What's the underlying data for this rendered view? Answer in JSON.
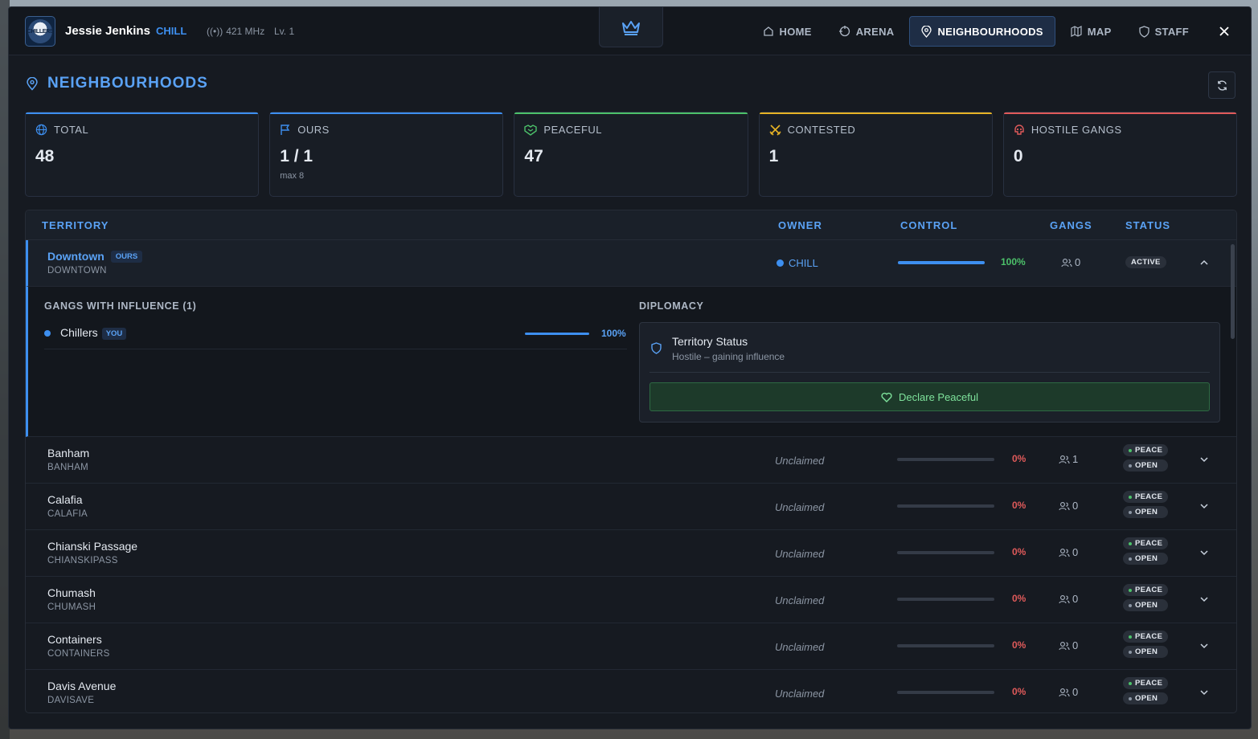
{
  "app": {
    "logo_text": "CHILLERS",
    "user_name": "Jessie Jenkins",
    "user_tag": "CHILL",
    "radio": "421 MHz",
    "level": "Lv. 1"
  },
  "nav": {
    "items": [
      {
        "label": "HOME",
        "icon": "home-icon"
      },
      {
        "label": "ARENA",
        "icon": "target-icon"
      },
      {
        "label": "NEIGHBOURHOODS",
        "icon": "pin-icon",
        "active": true
      },
      {
        "label": "MAP",
        "icon": "map-icon"
      },
      {
        "label": "STAFF",
        "icon": "shield-icon"
      }
    ],
    "close_icon": "close-icon"
  },
  "page": {
    "title": "NEIGHBOURHOODS"
  },
  "stats": [
    {
      "label": "TOTAL",
      "value": "48",
      "sub": "",
      "color": "#3d8ff0",
      "icon": "globe-icon"
    },
    {
      "label": "OURS",
      "value": "1 / 1",
      "sub": "max 8",
      "color": "#3d8ff0",
      "icon": "flag-icon"
    },
    {
      "label": "PEACEFUL",
      "value": "47",
      "sub": "",
      "color": "#4cc16a",
      "icon": "handshake-icon"
    },
    {
      "label": "CONTESTED",
      "value": "1",
      "sub": "",
      "color": "#e6b325",
      "icon": "swords-icon"
    },
    {
      "label": "HOSTILE GANGS",
      "value": "0",
      "sub": "",
      "color": "#e05a5a",
      "icon": "skull-icon"
    }
  ],
  "table": {
    "headers": {
      "territory": "TERRITORY",
      "owner": "OWNER",
      "control": "CONTROL",
      "gangs": "GANGS",
      "status": "STATUS"
    },
    "expanded": {
      "name": "Downtown",
      "badge": "OURS",
      "code": "DOWNTOWN",
      "owner": "CHILL",
      "control": 1.0,
      "control_label": "100%",
      "gangs": "0",
      "status": "ACTIVE",
      "influence_title": "GANGS WITH INFLUENCE (1)",
      "influence": [
        {
          "name": "Chillers",
          "badge": "YOU",
          "pct": "100%"
        }
      ],
      "diplomacy_title": "DIPLOMACY",
      "territory_status_title": "Territory Status",
      "territory_status_sub": "Hostile – gaining influence",
      "declare_label": "Declare Peaceful"
    },
    "rows": [
      {
        "name": "Banham",
        "code": "BANHAM",
        "owner": "Unclaimed",
        "control_label": "0%",
        "gangs": "1",
        "status": [
          "PEACE",
          "OPEN"
        ]
      },
      {
        "name": "Calafia",
        "code": "CALAFIA",
        "owner": "Unclaimed",
        "control_label": "0%",
        "gangs": "0",
        "status": [
          "PEACE",
          "OPEN"
        ]
      },
      {
        "name": "Chianski Passage",
        "code": "CHIANSKIPASS",
        "owner": "Unclaimed",
        "control_label": "0%",
        "gangs": "0",
        "status": [
          "PEACE",
          "OPEN"
        ]
      },
      {
        "name": "Chumash",
        "code": "CHUMASH",
        "owner": "Unclaimed",
        "control_label": "0%",
        "gangs": "0",
        "status": [
          "PEACE",
          "OPEN"
        ]
      },
      {
        "name": "Containers",
        "code": "CONTAINERS",
        "owner": "Unclaimed",
        "control_label": "0%",
        "gangs": "0",
        "status": [
          "PEACE",
          "OPEN"
        ]
      },
      {
        "name": "Davis Avenue",
        "code": "DAVISAVE",
        "owner": "Unclaimed",
        "control_label": "0%",
        "gangs": "0",
        "status": [
          "PEACE",
          "OPEN"
        ]
      }
    ]
  }
}
